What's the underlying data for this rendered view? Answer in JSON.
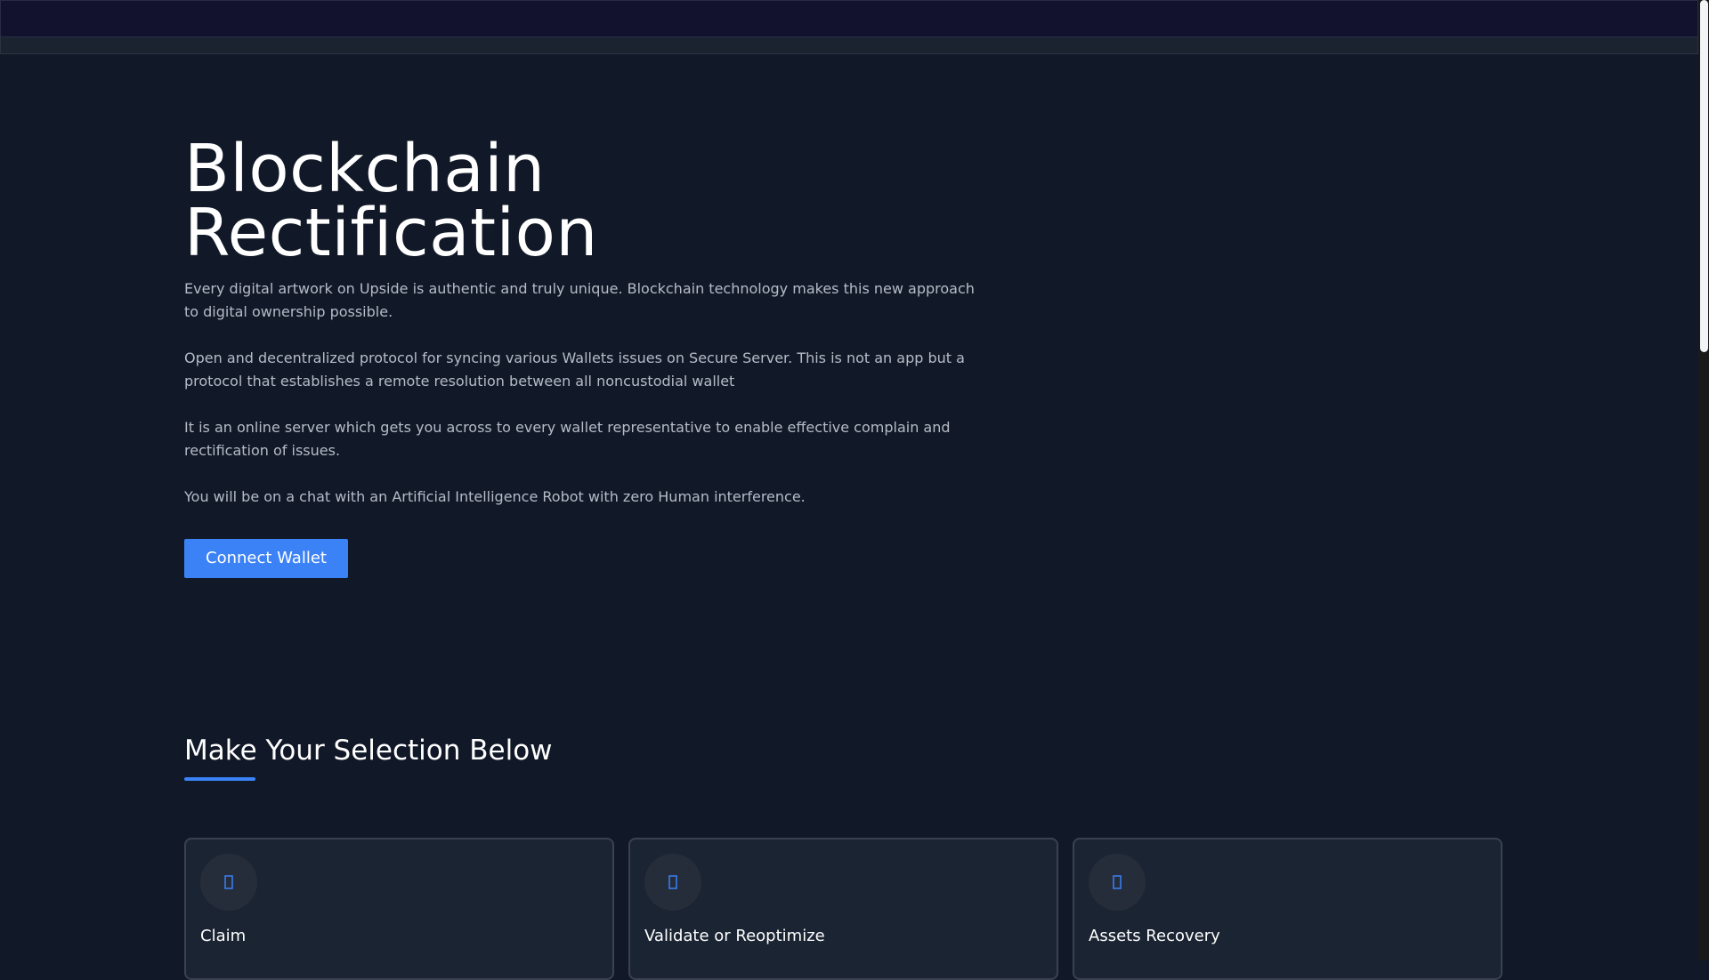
{
  "hero": {
    "title": "Blockchain Rectification",
    "paragraphs": [
      "Every digital artwork on Upside is authentic and truly unique. Blockchain technology makes this new approach to digital ownership possible.",
      "Open and decentralized protocol for syncing various Wallets issues on Secure Server. This is not an app but a protocol that establishes a remote resolution between all noncustodial wallet",
      "It is an online server which gets you across to every wallet representative to enable effective complain and rectification of issues.",
      "You will be on a chat with an Artificial Intelligence Robot with zero Human interference."
    ],
    "button_label": "Connect Wallet"
  },
  "selection": {
    "heading": "Make Your Selection Below",
    "cards": [
      {
        "title": "Claim",
        "icon": "placeholder-glyph-icon"
      },
      {
        "title": "Validate or Reoptimize",
        "icon": "placeholder-glyph-icon"
      },
      {
        "title": "Assets Recovery",
        "icon": "placeholder-glyph-icon"
      }
    ]
  },
  "colors": {
    "background": "#111827",
    "accent": "#3b82f6",
    "card_background": "#1b2433",
    "topbar": "#12112e"
  }
}
